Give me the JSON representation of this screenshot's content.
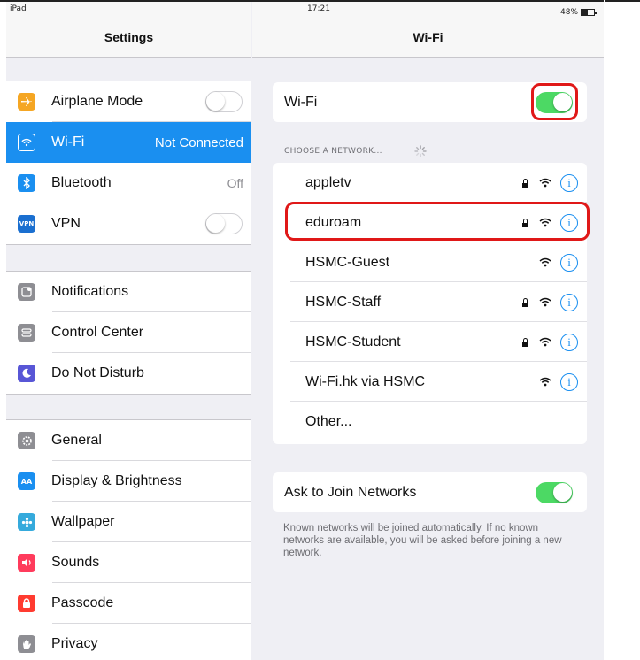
{
  "status_bar": {
    "device": "iPad",
    "time": "17:21",
    "battery": "48%",
    "battery_level": 0.48
  },
  "left_pane": {
    "title": "Settings",
    "group1": [
      {
        "label": "Airplane Mode",
        "icon": "airplane-icon",
        "icon_color": "#f5a623",
        "control": "toggle-off"
      },
      {
        "label": "Wi-Fi",
        "value": "Not Connected",
        "icon": "wifi-icon",
        "icon_color": "#1a8ff0",
        "selected": true
      },
      {
        "label": "Bluetooth",
        "value": "Off",
        "icon": "bluetooth-icon",
        "icon_color": "#1a8ff0"
      },
      {
        "label": "VPN",
        "icon": "vpn-icon",
        "icon_color": "#1a6fd0",
        "icon_text": "VPN",
        "control": "toggle-off"
      }
    ],
    "group2": [
      {
        "label": "Notifications",
        "icon": "notifications-icon",
        "icon_color": "#8e8e93"
      },
      {
        "label": "Control Center",
        "icon": "control-center-icon",
        "icon_color": "#8e8e93"
      },
      {
        "label": "Do Not Disturb",
        "icon": "moon-icon",
        "icon_color": "#5856d6"
      }
    ],
    "group3": [
      {
        "label": "General",
        "icon": "gear-icon",
        "icon_color": "#8e8e93"
      },
      {
        "label": "Display & Brightness",
        "icon": "display-icon",
        "icon_color": "#1a8ff0",
        "icon_text": "AA"
      },
      {
        "label": "Wallpaper",
        "icon": "wallpaper-icon",
        "icon_color": "#35aadc"
      },
      {
        "label": "Sounds",
        "icon": "speaker-icon",
        "icon_color": "#ff3b5c"
      },
      {
        "label": "Passcode",
        "icon": "lock-icon",
        "icon_color": "#ff3b30"
      },
      {
        "label": "Privacy",
        "icon": "hand-icon",
        "icon_color": "#8e8e93"
      }
    ]
  },
  "right_pane": {
    "title": "Wi-Fi",
    "wifi_toggle": {
      "label": "Wi-Fi",
      "on": true
    },
    "choose_network_label": "CHOOSE A NETWORK...",
    "networks": [
      {
        "name": "appletv",
        "secured": true
      },
      {
        "name": "eduroam",
        "secured": true,
        "highlighted": true
      },
      {
        "name": "HSMC-Guest",
        "secured": false
      },
      {
        "name": "HSMC-Staff",
        "secured": true
      },
      {
        "name": "HSMC-Student",
        "secured": true
      },
      {
        "name": "Wi-Fi.hk via HSMC",
        "secured": false
      }
    ],
    "other_label": "Other...",
    "ask_to_join": {
      "label": "Ask to Join Networks",
      "on": true
    },
    "footnote": "Known networks will be joined automatically. If no known networks are available, you will be asked before joining a new network."
  },
  "colors": {
    "accent": "#1a8ff0",
    "toggle_on": "#4cd964",
    "highlight_red": "#e01818",
    "background": "#efeff4"
  }
}
